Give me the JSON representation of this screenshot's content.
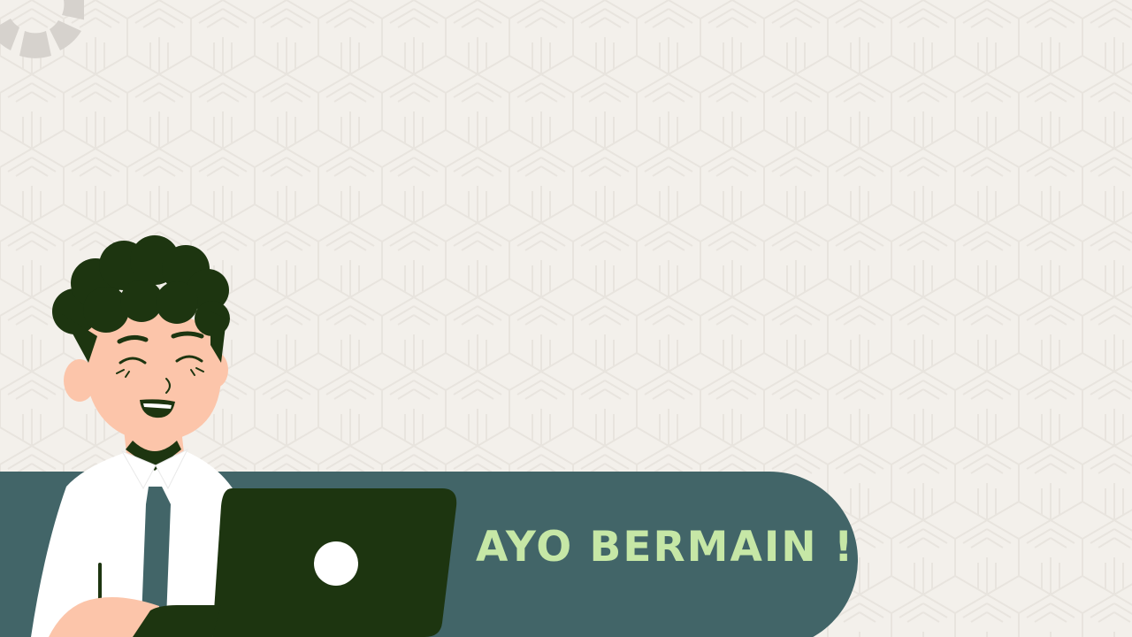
{
  "slide": {
    "banner_text": "AYO BERMAIN !"
  },
  "colors": {
    "background": "#f3f0eb",
    "banner": "#426568",
    "banner_text": "#c6e7a6",
    "hair": "#1d3510",
    "laptop": "#1d3510",
    "skin": "#fcc5aa",
    "shirt": "#ffffff",
    "tie": "#426568",
    "gear": "#d6d2cd"
  },
  "icons": [
    "gear-decoration",
    "laptop-logo"
  ]
}
